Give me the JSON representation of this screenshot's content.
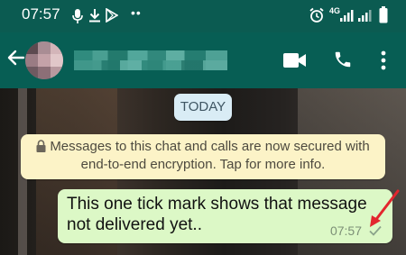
{
  "status_bar": {
    "time": "07:57",
    "network": "4G",
    "more": "••"
  },
  "header": {
    "contact_name": "",
    "icons": [
      "back-arrow-icon",
      "avatar",
      "video-call-icon",
      "voice-call-icon",
      "more-vert-icon"
    ]
  },
  "chat": {
    "date_chip": "TODAY",
    "encryption_notice_line1": "Messages to this chat and calls are now secured with",
    "encryption_notice_line2": "end-to-end encryption. Tap for more info.",
    "message": {
      "line1": "This one tick mark shows that message",
      "line2": "not delivered yet..",
      "time": "07:57",
      "status": "single-tick-sent"
    }
  },
  "colors": {
    "header": "#075e54",
    "bubble_out": "#dcf8c6",
    "notice": "#fcf3c7",
    "date_chip": "#d9ecf5",
    "annotation_arrow": "#e3262e"
  }
}
